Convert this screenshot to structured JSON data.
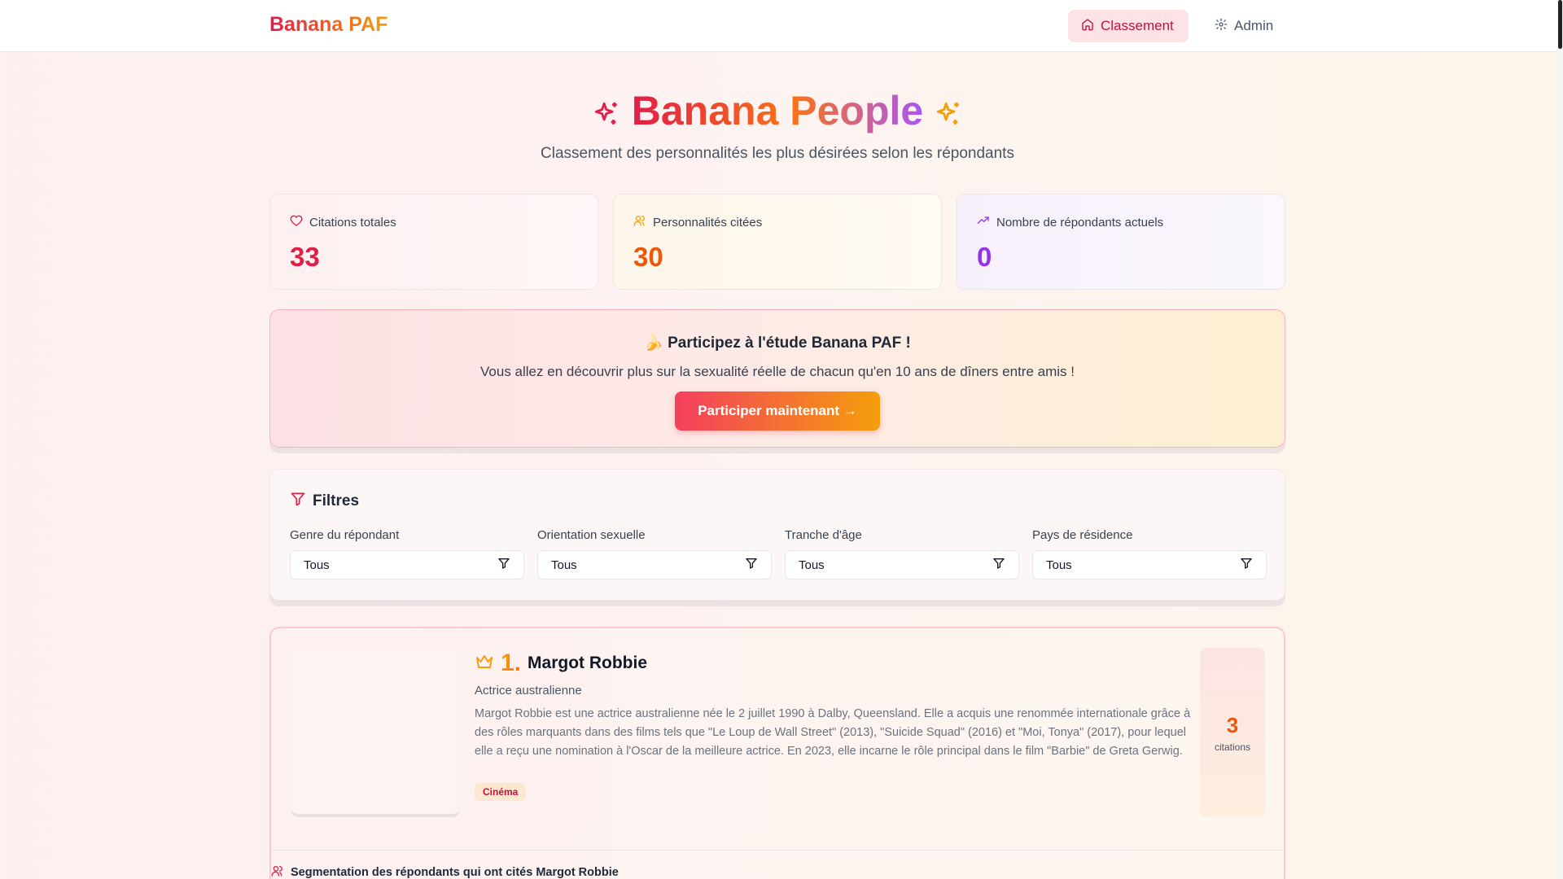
{
  "header": {
    "brand": "Banana PAF",
    "nav": {
      "classement": "Classement",
      "admin": "Admin"
    }
  },
  "hero": {
    "title": "Banana People",
    "subtitle": "Classement des personnalités les plus désirées selon les répondants"
  },
  "stats": [
    {
      "label": "Citations totales",
      "value": "33",
      "icon": "heart-icon"
    },
    {
      "label": "Personnalités citées",
      "value": "30",
      "icon": "users-icon"
    },
    {
      "label": "Nombre de répondants actuels",
      "value": "0",
      "icon": "trending-up-icon"
    }
  ],
  "cta": {
    "title": "🍌 Participez à l'étude Banana PAF !",
    "text": "Vous allez en découvrir plus sur la sexualité réelle de chacun qu'en 10 ans de dîners entre amis !",
    "button": "Participer maintenant →"
  },
  "filters": {
    "title": "Filtres",
    "items": [
      {
        "label": "Genre du répondant",
        "value": "Tous"
      },
      {
        "label": "Orientation sexuelle",
        "value": "Tous"
      },
      {
        "label": "Tranche d'âge",
        "value": "Tous"
      },
      {
        "label": "Pays de résidence",
        "value": "Tous"
      }
    ]
  },
  "ranking": [
    {
      "rank": "1.",
      "name": "Margot Robbie",
      "role": "Actrice australienne",
      "bio": "Margot Robbie est une actrice australienne née le 2 juillet 1990 à Dalby, Queensland. Elle a acquis une renommée internationale grâce à des rôles marquants dans des films tels que \"Le Loup de Wall Street\" (2013), \"Suicide Squad\" (2016) et \"Moi, Tonya\" (2017), pour lequel elle a reçu une nomination à l'Oscar de la meilleure actrice. En 2023, elle incarne le rôle principal dans le film \"Barbie\" de Greta Gerwig.",
      "tag": "Cinéma",
      "citations": "3",
      "citations_label": "citations",
      "segmentation_title": "Segmentation des répondants qui ont cités Margot Robbie"
    }
  ],
  "colors": {
    "accent_rose": "#e11d48",
    "accent_orange": "#f97316",
    "accent_purple": "#9333ea"
  }
}
